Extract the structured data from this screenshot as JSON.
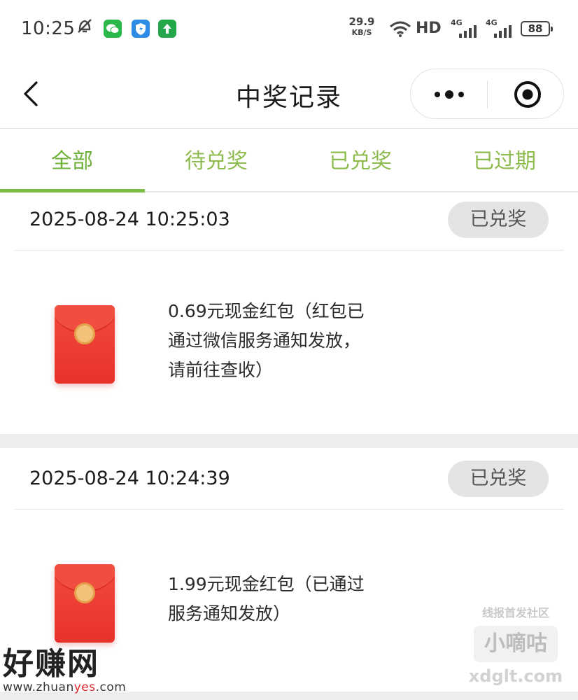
{
  "status_bar": {
    "time": "10:25",
    "speed_value": "29.9",
    "speed_unit": "KB/S",
    "hd_label": "HD",
    "signal1_label": "4G",
    "signal2_label": "4G",
    "battery": "88"
  },
  "nav": {
    "title": "中奖记录"
  },
  "tabs": [
    {
      "label": "全部",
      "active": true
    },
    {
      "label": "待兑奖",
      "active": false
    },
    {
      "label": "已兑奖",
      "active": false
    },
    {
      "label": "已过期",
      "active": false
    }
  ],
  "records": [
    {
      "time": "2025-08-24 10:25:03",
      "status": "已兑奖",
      "desc_lines": [
        "0.69元现金红包（红包已",
        "通过微信服务通知发放，",
        "请前往查收）"
      ]
    },
    {
      "time": "2025-08-24 10:24:39",
      "status": "已兑奖",
      "desc_lines": [
        "1.99元现金红包（已通过",
        "服务通知发放）"
      ]
    }
  ],
  "watermark_left": {
    "title": "好赚网",
    "url_prefix": "www.zhuan",
    "url_highlight": "yes",
    "url_suffix": ".com"
  },
  "watermark_right": {
    "top": "线报首发社区",
    "middle": "小嘀咕",
    "bottom": "xdglt.com"
  },
  "colors": {
    "tab_green": "#8dbb4e",
    "underline_green": "#7cbd44",
    "badge_bg": "#e4e4e4",
    "red_packet": "#e8312a"
  }
}
